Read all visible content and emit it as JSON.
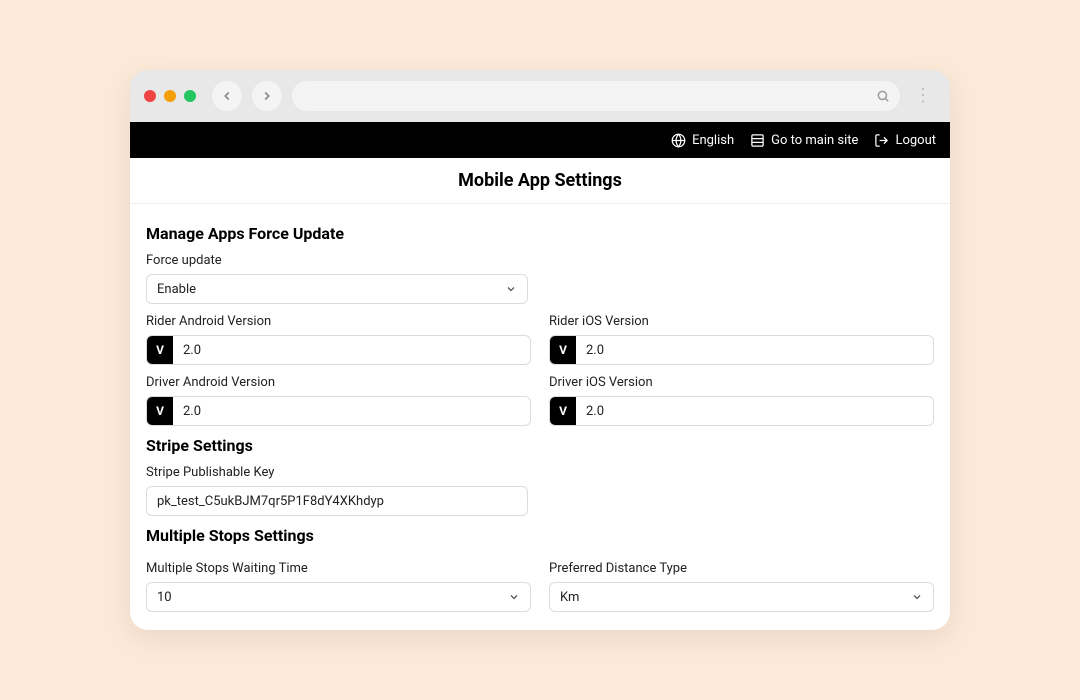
{
  "topbar": {
    "english": "English",
    "mainsite": "Go to main site",
    "logout": "Logout"
  },
  "page_title": "Mobile App Settings",
  "section_force": {
    "heading": "Manage Apps Force Update",
    "force_update_label": "Force update",
    "force_update_value": "Enable",
    "rider_android_label": "Rider Android Version",
    "rider_android_value": "2.0",
    "rider_ios_label": "Rider iOS Version",
    "rider_ios_value": "2.0",
    "driver_android_label": "Driver Android Version",
    "driver_android_value": "2.0",
    "driver_ios_label": "Driver iOS Version",
    "driver_ios_value": "2.0",
    "version_prefix": "V"
  },
  "section_stripe": {
    "heading": "Stripe Settings",
    "key_label": "Stripe Publishable Key",
    "key_value": "pk_test_C5ukBJM7qr5P1F8dY4XKhdyp"
  },
  "section_stops": {
    "heading": "Multiple Stops Settings",
    "wait_label": "Multiple Stops Waiting Time",
    "wait_value": "10",
    "dist_label": "Preferred Distance Type",
    "dist_value": "Km"
  }
}
